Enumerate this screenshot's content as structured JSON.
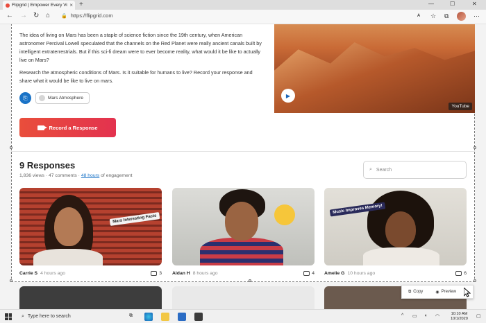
{
  "browser": {
    "tab_title": "Flipgrid | Empower Every Voice",
    "tab_close": "×",
    "new_tab": "+",
    "url": "https://flipgrid.com",
    "window_controls": [
      "—",
      "☐",
      "✕"
    ]
  },
  "topic": {
    "paragraph_1": "The idea of living on Mars has been a staple of science fiction since the 19th century, when American astronomer Percival Lowell speculated that the channels on the Red Planet were really ancient canals built by intelligent extraterrestrials. But if this sci-fi dream were to ever become reality, what would it be like to actually live on Mars?",
    "paragraph_2": "Research the atmospheric conditions of Mars. Is it suitable for humans to live? Record your response and share what it would be like to live on mars.",
    "resource_label": "Mars Atmosphere",
    "record_button": "Record a Response",
    "video_badge": "YouTube"
  },
  "responses": {
    "title": "9 Responses",
    "views": "1,836 views",
    "comments": "47 comments",
    "engagement_hours": "48 hours",
    "engagement_suffix": "of engagement",
    "search_placeholder": "Search",
    "items": [
      {
        "name": "Carrie S",
        "ago": "4 hours ago",
        "count": "3",
        "sticker": "Mars Interesting Facts"
      },
      {
        "name": "Aidan H",
        "ago": "8 hours ago",
        "count": "4"
      },
      {
        "name": "Amelie G",
        "ago": "10 hours ago",
        "count": "6",
        "sticker": "Music Improves Memory!"
      }
    ]
  },
  "context_menu": {
    "copy": "Copy",
    "preview": "Preview"
  },
  "taskbar": {
    "search_placeholder": "Type here to search",
    "time": "10:10 AM",
    "date": "10/1/2020"
  },
  "colors": {
    "accent": "#e94e3b",
    "link": "#1a73c7"
  }
}
